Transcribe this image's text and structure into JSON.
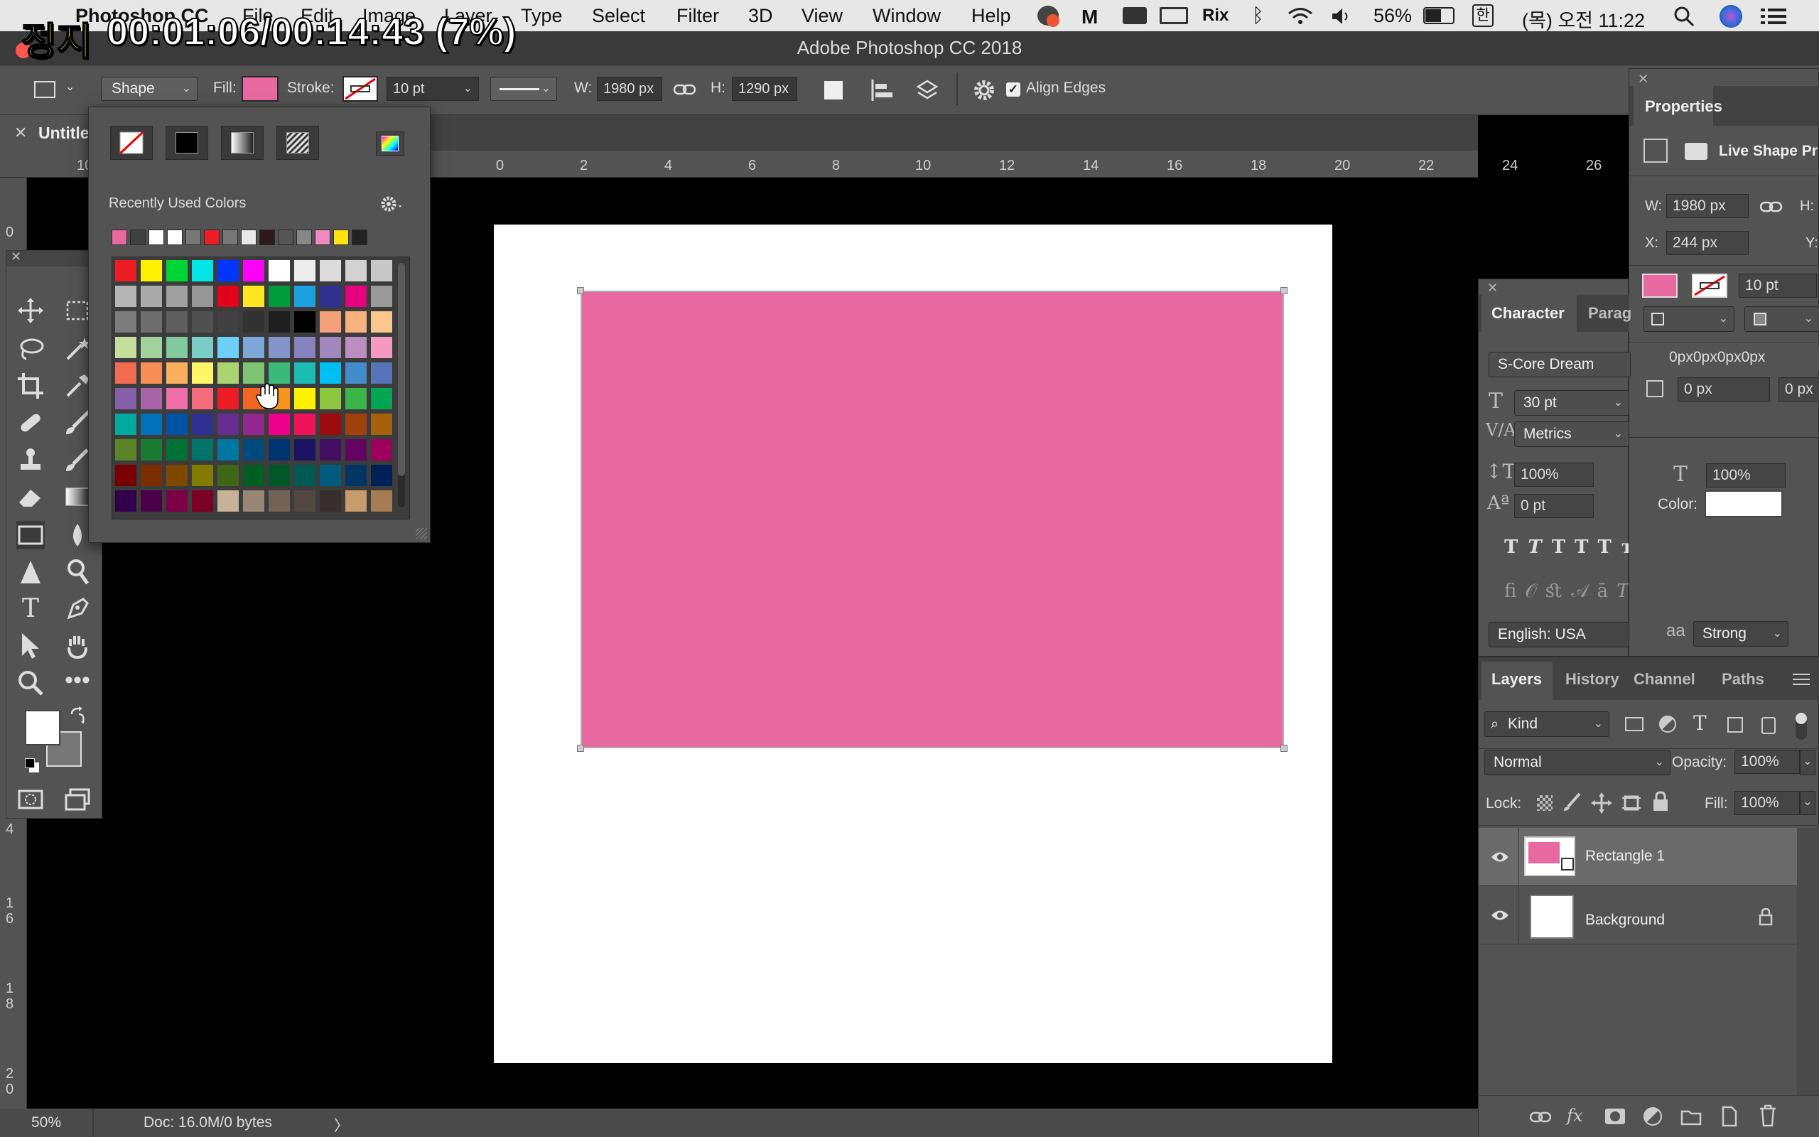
{
  "overlay": {
    "status": "정지",
    "time": "00:01:06/00:14:43 (7%)"
  },
  "menubar": {
    "app": "Photoshop CC",
    "menus": [
      "File",
      "Edit",
      "Image",
      "Layer",
      "Type",
      "Select",
      "Filter",
      "3D",
      "View",
      "Window",
      "Help"
    ],
    "battery": "56%",
    "input_source": "한",
    "clock": "(목) 오전 11:22",
    "status_text": "Rix"
  },
  "window": {
    "title": "Adobe Photoshop CC 2018"
  },
  "options": {
    "shape_mode": "Shape",
    "fill_label": "Fill:",
    "fill_color": "#e8699f",
    "stroke_label": "Stroke:",
    "stroke_width": "10 pt",
    "w_label": "W:",
    "width": "1980 px",
    "h_label": "H:",
    "height": "1290 px",
    "align_edges": "Align Edges",
    "align_edges_checked": true
  },
  "doc_tab": {
    "name": "Untitle"
  },
  "ruler": {
    "top": [
      "10",
      "0",
      "2",
      "4",
      "6",
      "8",
      "10",
      "12",
      "14",
      "16",
      "18",
      "20",
      "22",
      "24",
      "26"
    ],
    "left": [
      "0",
      "4",
      "1\n6",
      "1\n8",
      "2\n0"
    ]
  },
  "swatches": {
    "title": "Recently Used Colors",
    "recent": [
      "#e8699f",
      "#404040",
      "#ffffff",
      "#ffffff",
      "#777777",
      "#ee1c24",
      "#777777",
      "#e8e8e8",
      "#2a1a1a",
      "#555555",
      "#888888",
      "#f08ac0",
      "#ffe312",
      "#222222"
    ],
    "grid": [
      [
        "#ed1c24",
        "#fff200",
        "#00d633",
        "#00e6e6",
        "#0034ff",
        "#ff00ff",
        "#ffffff",
        "#ececec",
        "#dcdcdc",
        "#d2d2d2",
        "#c8c8c8"
      ],
      [
        "#b4b4b4",
        "#aaaaaa",
        "#a0a0a0",
        "#969696",
        "#e3001b",
        "#ffe61e",
        "#009b3a",
        "#1ba0e1",
        "#2e3192",
        "#e4007f",
        "#9a9a9a"
      ],
      [
        "#7d7d7d",
        "#6e6e6e",
        "#5f5f5f",
        "#505050",
        "#414141",
        "#323232",
        "#1e1e1e",
        "#000000",
        "#f4a07a",
        "#f7b27e",
        "#fbc78c"
      ],
      [
        "#c4df9b",
        "#a3d39c",
        "#82ca9d",
        "#7accc8",
        "#6dcff6",
        "#7da7d9",
        "#8493ca",
        "#8882be",
        "#a187be",
        "#bc8dbf",
        "#f49ac2"
      ],
      [
        "#f26d4f",
        "#f68e56",
        "#fbaf5d",
        "#fff568",
        "#acd372",
        "#7dc473",
        "#3cb878",
        "#1cbbb4",
        "#00bff3",
        "#438ccb",
        "#5574b9"
      ],
      [
        "#8560a8",
        "#a864a8",
        "#f06eaa",
        "#f26c7d",
        "#ed1c24",
        "#f26522",
        "#f7941d",
        "#fff200",
        "#8dc73f",
        "#39b54a",
        "#00a651"
      ],
      [
        "#00a99d",
        "#0072bc",
        "#0054a6",
        "#2e3192",
        "#662d91",
        "#92278f",
        "#ec008c",
        "#ed145b",
        "#9e0b0f",
        "#a0410d",
        "#a36209"
      ],
      [
        "#598527",
        "#1a7b30",
        "#007236",
        "#00746b",
        "#0076a3",
        "#004a80",
        "#003471",
        "#1b1464",
        "#440e62",
        "#630460",
        "#9e005d"
      ],
      [
        "#790000",
        "#7b2e00",
        "#7d4900",
        "#827b00",
        "#406618",
        "#005e20",
        "#005826",
        "#005952",
        "#005b7f",
        "#003663",
        "#002157"
      ],
      [
        "#32004b",
        "#4b0049",
        "#7b0046",
        "#7a0026",
        "#c7b299",
        "#998675",
        "#736357",
        "#534741",
        "#362f2d",
        "#c69c6d",
        "#a67c52"
      ]
    ]
  },
  "character": {
    "tabs": [
      "Character",
      "Parag"
    ],
    "font": "S-Core Dream",
    "size": "30 pt",
    "kerning": "Metrics",
    "vscale": "100%",
    "hscale": "100%",
    "baseline": "0 pt",
    "color_label": "Color:",
    "language": "English: USA",
    "aa_icon": "aa",
    "antialias": "Strong"
  },
  "properties": {
    "title": "Properties",
    "subtitle": "Live Shape Pr",
    "w_label": "W:",
    "w": "1980 px",
    "h_label": "H:",
    "x_label": "X:",
    "x": "244 px",
    "y_label": "Y:",
    "stroke": "10 pt",
    "corners": "0px0px0px0px",
    "corner1": "0 px",
    "corner2": "0 px"
  },
  "layers": {
    "tabs": [
      "Layers",
      "History",
      "Channel",
      "Paths"
    ],
    "filter": "Kind",
    "blend": "Normal",
    "opacity_label": "Opacity:",
    "opacity": "100%",
    "lock_label": "Lock:",
    "fill_label": "Fill:",
    "fill": "100%",
    "items": [
      {
        "name": "Rectangle 1",
        "color": "#e8699f"
      },
      {
        "name": "Background",
        "color": "#ffffff"
      }
    ]
  },
  "status": {
    "zoom": "50%",
    "doc": "Doc: 16.0M/0 bytes",
    "arrow": "〉"
  }
}
